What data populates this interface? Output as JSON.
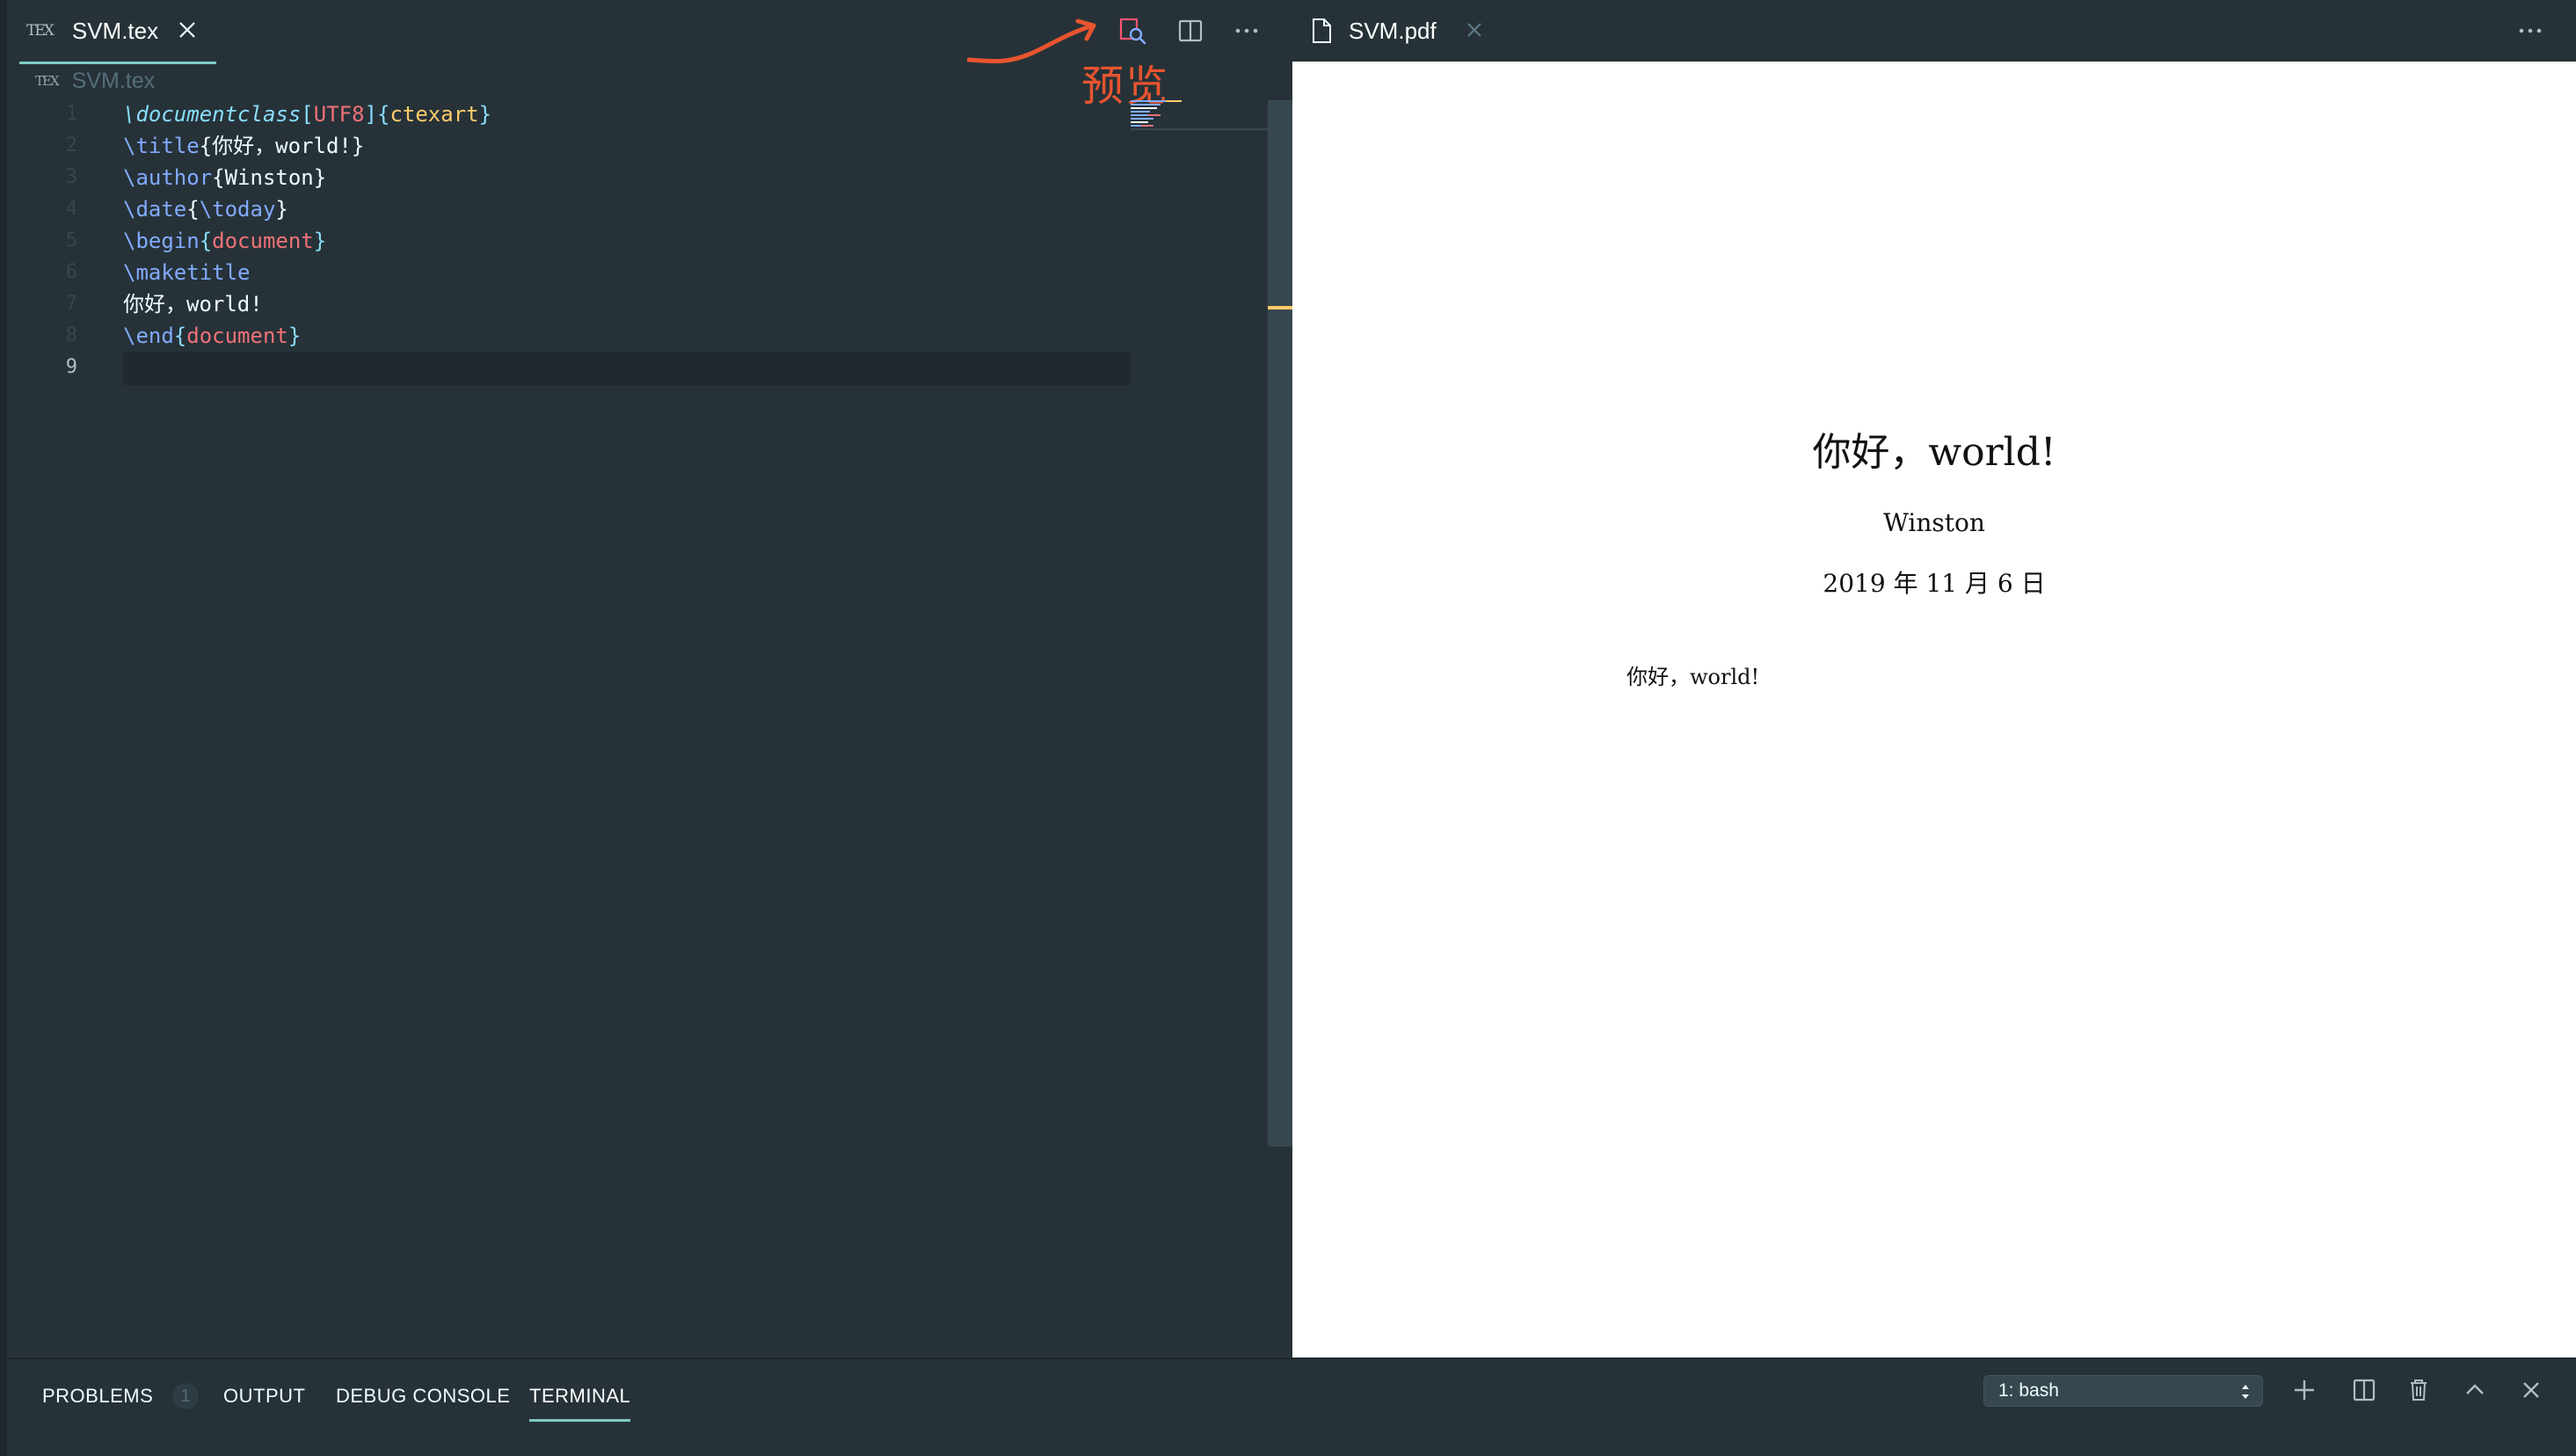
{
  "editor": {
    "tab_label": "SVM.tex",
    "tab_icon": "tex-file-icon",
    "tex_logo": "TEX",
    "breadcrumb": "SVM.tex",
    "annotation": "预览",
    "lines": [
      {
        "n": "1",
        "tokens": [
          {
            "t": "\\documentclass",
            "c": "cmd-i"
          },
          {
            "t": "[",
            "c": "br"
          },
          {
            "t": "UTF8",
            "c": "opt"
          },
          {
            "t": "]{",
            "c": "br"
          },
          {
            "t": "ctexart",
            "c": "cls"
          },
          {
            "t": "}",
            "c": "br"
          }
        ]
      },
      {
        "n": "2",
        "tokens": [
          {
            "t": "\\title",
            "c": "cmd"
          },
          {
            "t": "{你好，world!}",
            "c": "txt"
          }
        ]
      },
      {
        "n": "3",
        "tokens": [
          {
            "t": "\\author",
            "c": "cmd"
          },
          {
            "t": "{Winston}",
            "c": "txt"
          }
        ]
      },
      {
        "n": "4",
        "tokens": [
          {
            "t": "\\date",
            "c": "cmd"
          },
          {
            "t": "{",
            "c": "txt"
          },
          {
            "t": "\\today",
            "c": "cmd"
          },
          {
            "t": "}",
            "c": "txt"
          }
        ]
      },
      {
        "n": "5",
        "tokens": [
          {
            "t": "\\begin",
            "c": "cmd"
          },
          {
            "t": "{",
            "c": "br"
          },
          {
            "t": "document",
            "c": "env"
          },
          {
            "t": "}",
            "c": "br"
          }
        ]
      },
      {
        "n": "6",
        "tokens": [
          {
            "t": "\\maketitle",
            "c": "cmd"
          }
        ]
      },
      {
        "n": "7",
        "tokens": [
          {
            "t": "你好，world!",
            "c": "txt"
          }
        ]
      },
      {
        "n": "8",
        "tokens": [
          {
            "t": "\\end",
            "c": "cmd"
          },
          {
            "t": "{",
            "c": "br"
          },
          {
            "t": "document",
            "c": "env"
          },
          {
            "t": "}",
            "c": "br"
          }
        ]
      },
      {
        "n": "9",
        "tokens": []
      }
    ],
    "active_line": "9"
  },
  "pdf": {
    "tab_label": "SVM.pdf",
    "title": "你好，world!",
    "author": "Winston",
    "date": "2019 年 11 月 6 日",
    "body": "你好，world!"
  },
  "panel": {
    "tabs": [
      {
        "label": "PROBLEMS",
        "badge": "1"
      },
      {
        "label": "OUTPUT"
      },
      {
        "label": "DEBUG CONSOLE"
      },
      {
        "label": "TERMINAL",
        "active": true
      }
    ],
    "terminal_select": "1: bash"
  },
  "colors": {
    "background": "#263238",
    "accent": "#80cbc4",
    "annotation": "#e8552f"
  }
}
